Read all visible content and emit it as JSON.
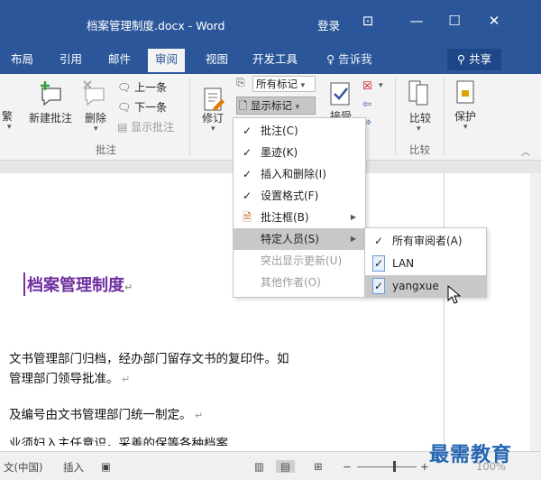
{
  "window": {
    "title": "档案管理制度.docx - Word",
    "login": "登录",
    "controls": [
      "⊡",
      "—",
      "☐",
      "✕"
    ]
  },
  "tabs": [
    {
      "label": "布局"
    },
    {
      "label": "引用"
    },
    {
      "label": "邮件"
    },
    {
      "label": "审阅",
      "active": true
    },
    {
      "label": "视图"
    },
    {
      "label": "开发工具"
    }
  ],
  "tell_me": "告诉我",
  "share": "共享",
  "ribbon": {
    "partial_left": "繁",
    "new_comment": "新建批注",
    "delete": "删除",
    "prev": "上一条",
    "next": "下一条",
    "show_comments": "显示批注",
    "comments_group": "批注",
    "track_changes": "修订",
    "markup_mode": "所有标记",
    "show_markup": "显示标记",
    "accept": "接受",
    "compare": "比较",
    "compare_group": "比较",
    "protect": "保护"
  },
  "markup_menu": {
    "items": [
      {
        "label": "批注(C)",
        "checked": true,
        "disabled": false,
        "submenu": false
      },
      {
        "label": "墨迹(K)",
        "checked": true,
        "disabled": false,
        "submenu": false
      },
      {
        "label": "插入和删除(I)",
        "checked": true,
        "disabled": false,
        "submenu": false
      },
      {
        "label": "设置格式(F)",
        "checked": true,
        "disabled": false,
        "submenu": false
      },
      {
        "label": "批注框(B)",
        "checked": false,
        "disabled": false,
        "submenu": true
      },
      {
        "label": "特定人员(S)",
        "checked": false,
        "disabled": false,
        "submenu": true
      },
      {
        "label": "突出显示更新(U)",
        "checked": false,
        "disabled": true,
        "submenu": false
      },
      {
        "label": "其他作者(O)",
        "checked": false,
        "disabled": true,
        "submenu": false
      }
    ]
  },
  "people_menu": {
    "items": [
      {
        "label": "所有审阅者(A)",
        "checked": true
      },
      {
        "label": "LAN",
        "checked": true
      },
      {
        "label": "yangxue",
        "checked": true
      }
    ]
  },
  "document": {
    "title": "档案管理制度",
    "lines": [
      "文书管理部门归档，经办部门留存文书的复印件。如",
      "管理部门领导批准。",
      "及编号由文书管理部门统一制定。",
      "业须妇入主任意识，采善的保等各种档案"
    ]
  },
  "status": {
    "language": "文(中国)",
    "insert": "插入",
    "zoom": "100%"
  },
  "watermark": "最需教育",
  "colors": {
    "accent": "#2b579a",
    "title_purple": "#7030a0",
    "watermark": "#2566b4"
  }
}
